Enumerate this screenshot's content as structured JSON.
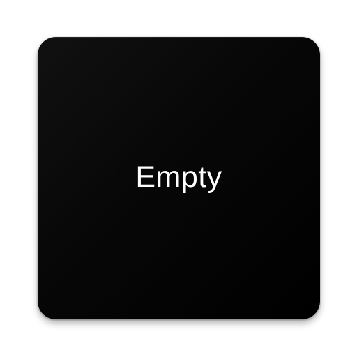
{
  "app_icon": {
    "label": "Empty",
    "background_color": "#000000",
    "text_color": "#ffffff"
  }
}
